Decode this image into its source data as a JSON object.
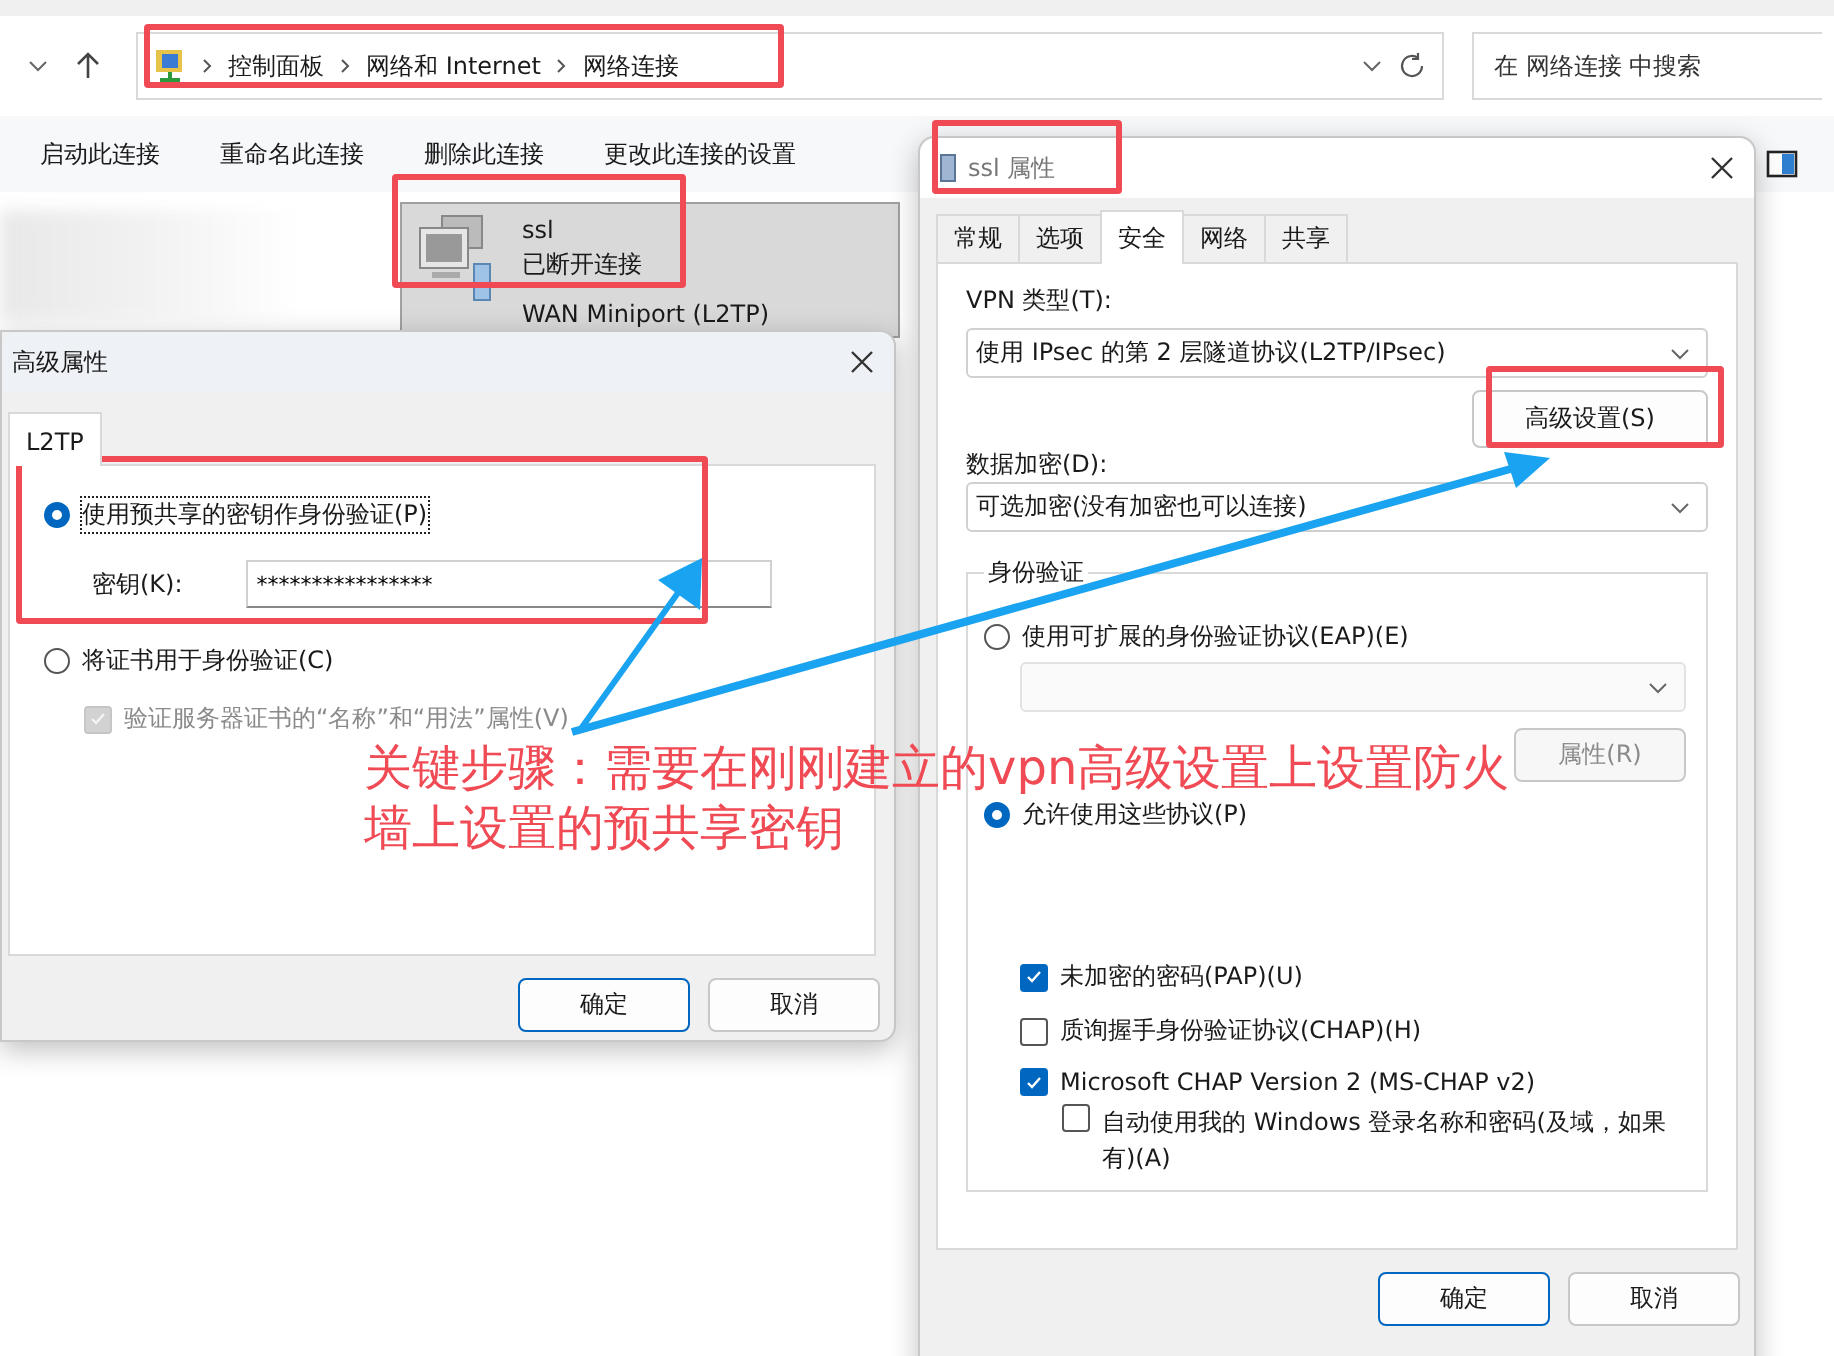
{
  "explorer": {
    "breadcrumb": [
      "控制面板",
      "网络和 Internet",
      "网络连接"
    ],
    "search": {
      "placeholder": "在 网络连接 中搜索"
    },
    "commands": [
      "启动此连接",
      "重命名此连接",
      "删除此连接",
      "更改此连接的设置"
    ],
    "connection": {
      "name": "ssl",
      "status": "已断开连接",
      "device": "WAN Miniport (L2TP)",
      "selected": true
    }
  },
  "advanced_dialog": {
    "title": "高级属性",
    "tabs": [
      {
        "label": "L2TP",
        "selected": true
      }
    ],
    "psk_option": {
      "label": "使用预共享的密钥作身份验证(P)",
      "selected": true
    },
    "key_field": {
      "label": "密钥(K):",
      "value": "****************"
    },
    "cert_option": {
      "label": "将证书用于身份验证(C)",
      "selected": false
    },
    "verify_check": {
      "label": "验证服务器证书的“名称”和“用法”属性(V)",
      "checked": true,
      "disabled": true
    },
    "buttons": [
      "确定",
      "取消"
    ]
  },
  "ssl_dialog": {
    "title": "ssl 属性",
    "tabs": [
      {
        "label": "常规",
        "selected": false
      },
      {
        "label": "选项",
        "selected": false
      },
      {
        "label": "安全",
        "selected": true
      },
      {
        "label": "网络",
        "selected": false
      },
      {
        "label": "共享",
        "selected": false
      }
    ],
    "vpn_type": {
      "label": "VPN 类型(T):",
      "value": "使用 IPsec 的第 2 层隧道协议(L2TP/IPsec)"
    },
    "advanced_button": "高级设置(S)",
    "encryption": {
      "label": "数据加密(D):",
      "value": "可选加密(没有加密也可以连接)"
    },
    "auth": {
      "title": "身份验证",
      "eap": {
        "label": "使用可扩展的身份验证协议(EAP)(E)",
        "selected": false
      },
      "eap_dropdown": {
        "disabled": true
      },
      "properties_button": {
        "label": "属性(R)",
        "disabled": true
      },
      "allow": {
        "label": "允许使用这些协议(P)",
        "selected": true
      },
      "protocols": [
        {
          "label": "未加密的密码(PAP)(U)",
          "checked": true
        },
        {
          "label": "质询握手身份验证协议(CHAP)(H)",
          "checked": false
        },
        {
          "label": "Microsoft CHAP Version 2 (MS-CHAP v2)",
          "checked": true,
          "children": [
            {
              "label": "自动使用我的 Windows 登录名称和密码(及域，如果有)(A)",
              "checked": false
            }
          ]
        }
      ]
    },
    "buttons": [
      "确定",
      "取消"
    ]
  },
  "annotation": {
    "caption_lines": [
      "关键步骤：需要在刚刚建立的vpn高级设置上设置防火",
      "墙上设置的预共享密钥"
    ]
  }
}
